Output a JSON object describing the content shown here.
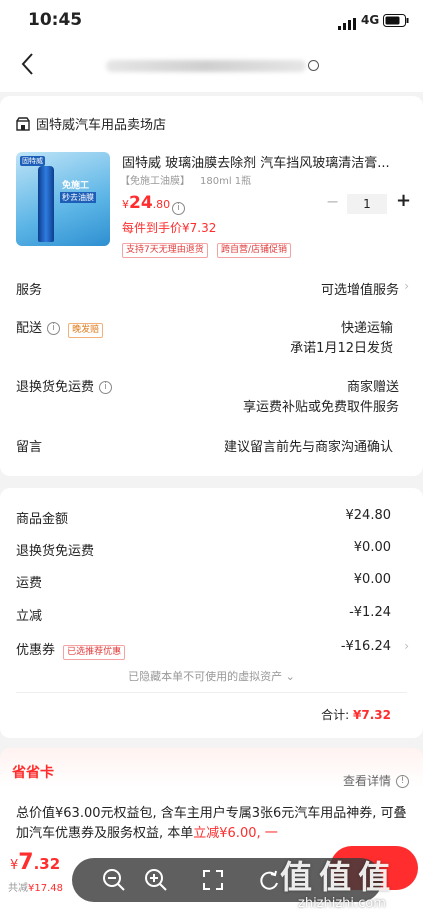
{
  "status_bar": {
    "time": "10:45",
    "network": "4G"
  },
  "nav": {
    "back_glyph": "‹"
  },
  "store": {
    "name": "固特威汽车用品卖场店"
  },
  "product": {
    "image_badge": "固特威",
    "image_text1": "免施工",
    "image_text2": "秒去油膜",
    "title": "固特威 玻璃油膜去除剂 汽车挡风玻璃清洁膏...",
    "spec_tag": "【免施工油膜】",
    "spec": "180ml 1瓶",
    "price_symbol": "¥",
    "price_int": "24",
    "price_dec": ".80",
    "unit_price": "每件到手价¥7.32",
    "tag1": "支持7天无理由退货",
    "tag2": "跨自营/店铺促销",
    "qty_minus": "−",
    "qty": "1",
    "qty_plus": "+"
  },
  "rows": {
    "service_label": "服务",
    "service_value": "可选增值服务",
    "delivery_label": "配送",
    "delivery_badge": "晚发赔",
    "delivery_value1": "快递运输",
    "delivery_value2": "承诺1月12日发货",
    "return_label": "退换货免运费",
    "return_value1": "商家赠送",
    "return_value2": "享运费补贴或免费取件服务",
    "message_label": "留言",
    "message_placeholder": "建议留言前先与商家沟通确认"
  },
  "summary": {
    "goods_label": "商品金额",
    "goods_value": "¥24.80",
    "return_label": "退换货免运费",
    "return_value": "¥0.00",
    "ship_label": "运费",
    "ship_value": "¥0.00",
    "discount_label": "立减",
    "discount_value": "-¥1.24",
    "coupon_label": "优惠券",
    "coupon_badge": "已选推荐优惠",
    "coupon_value": "-¥16.24",
    "hidden_assets": "已隐藏本单不可使用的虚拟资产",
    "total_label": "合计:",
    "total_value": "¥7.32"
  },
  "saver": {
    "title": "省省卡",
    "detail_link": "查看详情",
    "desc_part1": "总价值¥63.00元权益包, 含车主用户专属3张6元汽车用品神券, 可叠加汽车优惠券及服务权益, 本单",
    "desc_highlight": "立减¥6.00, 一"
  },
  "bottom": {
    "price_symbol": "¥",
    "price_int": "7",
    "price_dec": ".32",
    "saved_label": "共减",
    "saved_value": "¥17.48",
    "watermark": "值 值 值",
    "watermark_url": "zhizhizhi.com"
  },
  "colors": {
    "accent": "#ff2d2d",
    "bg": "#f3f3f3"
  }
}
